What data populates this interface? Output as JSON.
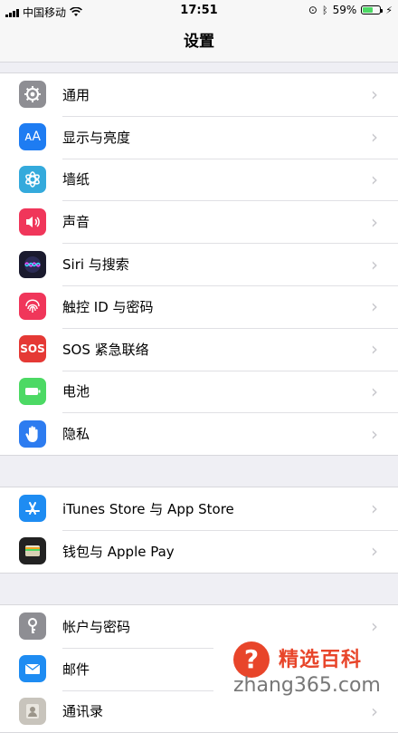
{
  "status": {
    "carrier": "中国移动",
    "time": "17:51",
    "battery_percent": "59%",
    "battery_level": 0.59
  },
  "nav": {
    "title": "设置"
  },
  "groups": [
    {
      "items": [
        {
          "label": "通用",
          "icon": "gear-icon",
          "color": "#8e8e93"
        },
        {
          "label": "显示与亮度",
          "icon": "display-icon",
          "color": "#1e7cf2"
        },
        {
          "label": "墙纸",
          "icon": "wallpaper-icon",
          "color": "#34aadc"
        },
        {
          "label": "声音",
          "icon": "speaker-icon",
          "color": "#f0365a"
        },
        {
          "label": "Siri 与搜索",
          "icon": "siri-icon",
          "color": "#1a1a2e"
        },
        {
          "label": "触控 ID 与密码",
          "icon": "fingerprint-icon",
          "color": "#f0365a"
        },
        {
          "label": "SOS 紧急联络",
          "icon": "sos-icon",
          "color": "#e53935",
          "text": "SOS"
        },
        {
          "label": "电池",
          "icon": "battery-icon",
          "color": "#4cd964"
        },
        {
          "label": "隐私",
          "icon": "hand-icon",
          "color": "#2d7cf0"
        }
      ]
    },
    {
      "items": [
        {
          "label": "iTunes Store 与 App Store",
          "icon": "app-store-icon",
          "color": "#1e8cf2"
        },
        {
          "label": "钱包与 Apple Pay",
          "icon": "wallet-icon",
          "color": "#222222"
        }
      ]
    },
    {
      "items": [
        {
          "label": "帐户与密码",
          "icon": "key-icon",
          "color": "#8e8e93"
        },
        {
          "label": "邮件",
          "icon": "mail-icon",
          "color": "#1e8cf2"
        },
        {
          "label": "通讯录",
          "icon": "contacts-icon",
          "color": "#c8c4bc"
        }
      ]
    }
  ],
  "watermark": {
    "brand": "精选百科",
    "url": "zhang365.com"
  }
}
